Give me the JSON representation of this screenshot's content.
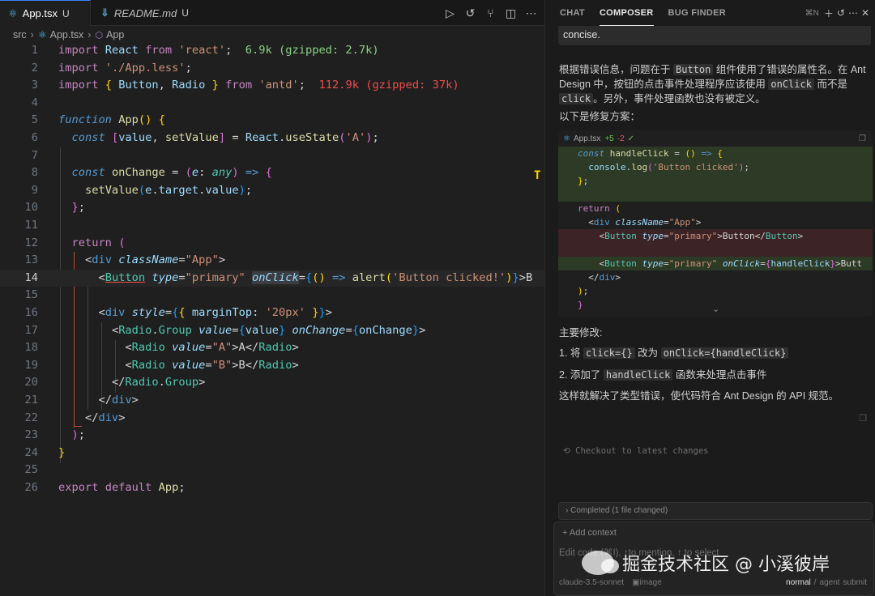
{
  "editor": {
    "tabs": [
      {
        "label": "App.tsx",
        "badge": "U",
        "icon": "react-icon"
      },
      {
        "label": "README.md",
        "badge": "U",
        "icon": "markdown-icon"
      }
    ],
    "actions": [
      "run-icon",
      "history-icon",
      "branch-icon",
      "split-icon",
      "more-icon"
    ],
    "breadcrumb": {
      "folder": "src",
      "file": "App.tsx",
      "symbol": "App"
    },
    "line_numbers": [
      "1",
      "2",
      "3",
      "4",
      "5",
      "6",
      "7",
      "8",
      "9",
      "10",
      "11",
      "12",
      "13",
      "14",
      "15",
      "16",
      "17",
      "18",
      "19",
      "20",
      "21",
      "22",
      "23",
      "24",
      "25",
      "26"
    ],
    "current_line": 14,
    "import_sizes": {
      "react": "6.9k (gzipped: 2.7k)",
      "antd": "112.9k (gzipped: 37k)"
    }
  },
  "panel": {
    "tabs": [
      "CHAT",
      "COMPOSER",
      "BUG FINDER"
    ],
    "active_tab": "COMPOSER",
    "shortcut": "⌘N",
    "previous_message_tail": "concise.",
    "explanation": {
      "p1_a": "根据错误信息，问题在于",
      "p1_code1": "Button",
      "p1_b": "组件使用了错误的属性名。在 Ant Design 中，按钮的点击事件处理程序应该使用",
      "p1_code2": "onClick",
      "p1_c": "而不是",
      "p1_code3": "click",
      "p1_d": "。另外，事件处理函数也没有被定义。",
      "p2": "以下是修复方案："
    },
    "diff": {
      "file": "App.tsx",
      "added": "+5",
      "removed": "-2",
      "check": "✓"
    },
    "summary": {
      "title": "主要修改:",
      "item1_prefix": "1. 将",
      "item1_from": "click={}",
      "item1_mid": "改为",
      "item1_to": "onClick={handleClick}",
      "item2_prefix": "2. 添加了",
      "item2_code": "handleClick",
      "item2_suffix": "函数来处理点击事件",
      "conclusion": "这样就解决了类型错误，使代码符合 Ant Design 的 API 规范。"
    },
    "checkout_label": "Checkout to latest changes",
    "completed_label": "Completed (1 file changed)",
    "input": {
      "add_context": "+ Add context",
      "placeholder": "Edit code (⌘I), ↑to mention, ↑ to select",
      "model": "claude-3.5-sonnet",
      "image_label": "image",
      "mode_normal": "normal",
      "mode_agent": "agent",
      "submit": "submit"
    }
  },
  "watermark": {
    "text": "掘金技术社区 @ 小溪彼岸"
  }
}
